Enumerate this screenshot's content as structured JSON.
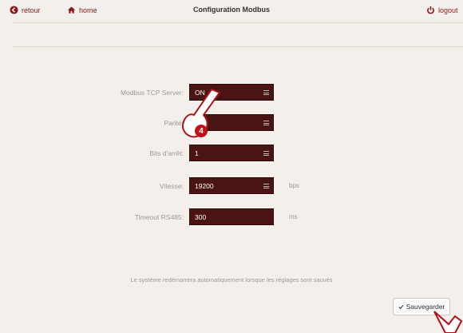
{
  "header": {
    "back_label": "retour",
    "home_label": "home",
    "title": "Configuration Modbus",
    "logout_label": "logout"
  },
  "form": {
    "rows": [
      {
        "label": "Modbus TCP Server:",
        "value": "ON",
        "unit": ""
      },
      {
        "label": "Parité:",
        "value": "",
        "unit": ""
      },
      {
        "label": "Bits d'arrêt:",
        "value": "1",
        "unit": ""
      },
      {
        "label": "Vitesse:",
        "value": "19200",
        "unit": "bps"
      },
      {
        "label": "Timeout RS485:",
        "value": "300",
        "unit": "ms"
      }
    ]
  },
  "note": "Le système redémarrera automatiquement lorsque les réglages sont sauvés",
  "save_label": "Sauvegarder",
  "annotation_number": "4",
  "colors": {
    "accent": "#8b1a1a",
    "field_bg": "#4a1414",
    "badge": "#c0141a"
  }
}
